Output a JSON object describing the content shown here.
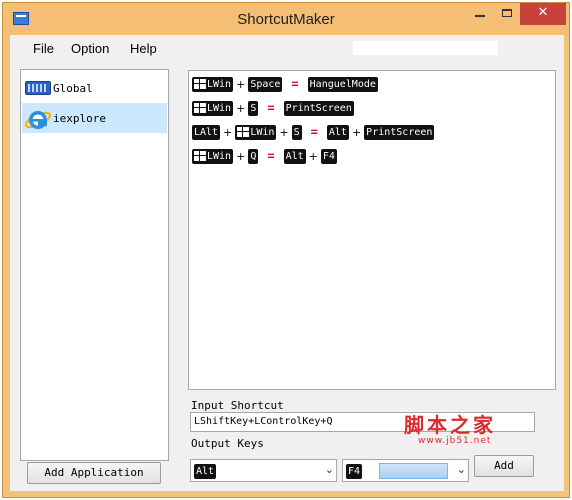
{
  "window": {
    "title": "ShortcutMaker",
    "accent": "#f4bf74"
  },
  "controls": {
    "minimize": "minimize",
    "maximize": "maximize",
    "close": "✕"
  },
  "menu": {
    "items": [
      "File",
      "Option",
      "Help"
    ]
  },
  "apps": [
    {
      "label": "Global",
      "icon": "keyboard-icon",
      "selected": false
    },
    {
      "label": "iexplore",
      "icon": "internet-explorer-icon",
      "selected": true
    }
  ],
  "rules": [
    {
      "inputs": [
        "LWin",
        "Space"
      ],
      "outputs": [
        "HanguelMode"
      ]
    },
    {
      "inputs": [
        "LWin",
        "S"
      ],
      "outputs": [
        "PrintScreen"
      ]
    },
    {
      "inputs": [
        "LAlt",
        "LWin",
        "S"
      ],
      "outputs": [
        "Alt",
        "PrintScreen"
      ]
    },
    {
      "inputs": [
        "LWin",
        "Q"
      ],
      "outputs": [
        "Alt",
        "F4"
      ]
    }
  ],
  "symbols": {
    "plus": "+",
    "equals": "="
  },
  "input_shortcut": {
    "label": "Input Shortcut",
    "value": "LShiftKey+LControlKey+Q"
  },
  "output_keys": {
    "label": "Output Keys",
    "key1": "Alt",
    "key2": "F4"
  },
  "buttons": {
    "add_application": "Add Application",
    "add": "Add"
  },
  "watermark": {
    "text": "脚本之家",
    "url": "www.jb51.net"
  }
}
